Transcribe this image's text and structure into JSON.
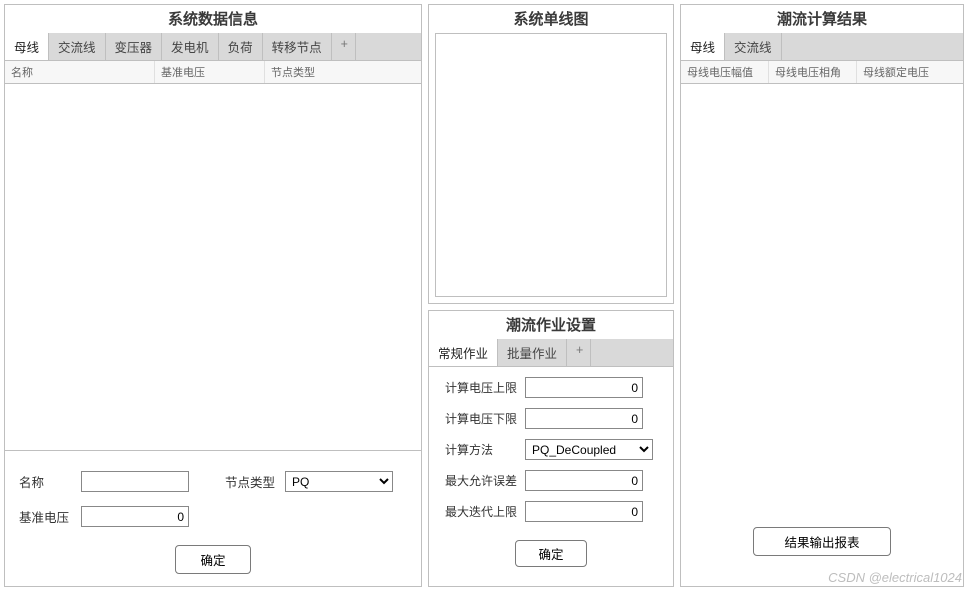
{
  "left": {
    "title": "系统数据信息",
    "tabs": [
      "母线",
      "交流线",
      "变压器",
      "发电机",
      "负荷",
      "转移节点"
    ],
    "addTab": "+",
    "cols": [
      "名称",
      "基准电压",
      "节点类型"
    ],
    "form": {
      "nameLabel": "名称",
      "nameValue": "",
      "baseVLabel": "基准电压",
      "baseVValue": "0",
      "nodeTypeLabel": "节点类型",
      "nodeTypeValue": "PQ",
      "confirm": "确定"
    }
  },
  "midTop": {
    "title": "系统单线图"
  },
  "midBottom": {
    "title": "潮流作业设置",
    "tabs": [
      "常规作业",
      "批量作业"
    ],
    "addTab": "+",
    "f": {
      "vmaxLabel": "计算电压上限",
      "vmaxValue": "0",
      "vminLabel": "计算电压下限",
      "vminValue": "0",
      "methodLabel": "计算方法",
      "methodValue": "PQ_DeCoupled",
      "tolLabel": "最大允许误差",
      "tolValue": "0",
      "iterLabel": "最大迭代上限",
      "iterValue": "0",
      "confirm": "确定"
    }
  },
  "right": {
    "title": "潮流计算结果",
    "tabs": [
      "母线",
      "交流线"
    ],
    "cols": [
      "母线电压幅值",
      "母线电压相角",
      "母线额定电压"
    ],
    "exportBtn": "结果输出报表"
  },
  "watermark": "CSDN @electrical1024"
}
